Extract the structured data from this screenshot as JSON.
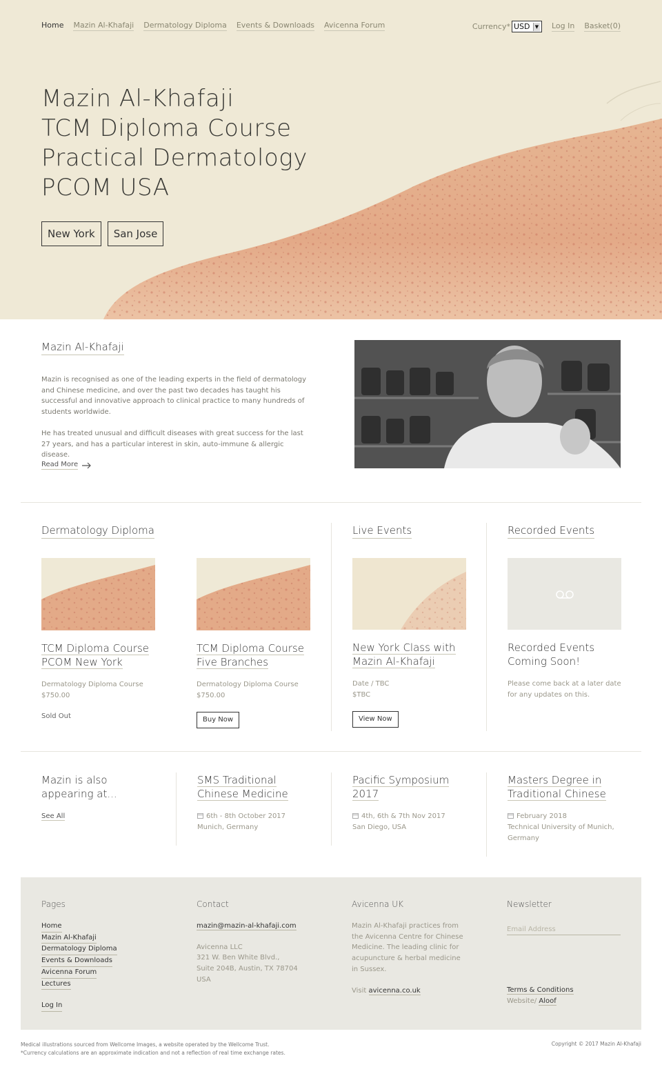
{
  "nav": {
    "items": [
      {
        "label": "Home"
      },
      {
        "label": "Mazin Al-Khafaji"
      },
      {
        "label": "Dermatology Diploma"
      },
      {
        "label": "Events & Downloads"
      },
      {
        "label": "Avicenna Forum"
      }
    ],
    "currency_label": "Currency*",
    "currency_value": "USD",
    "login": "Log In",
    "basket": "Basket(0)"
  },
  "hero": {
    "lines": [
      "Mazin Al-Khafaji",
      "TCM Diploma Course",
      "Practical Dermatology",
      "PCOM USA"
    ],
    "buttons": [
      "New York",
      "San Jose"
    ]
  },
  "about": {
    "title": "Mazin Al-Khafaji",
    "para1": "Mazin is recognised as one of the leading experts in the field of dermatology and Chinese medicine, and over the past two decades has taught his successful and innovative approach to clinical practice to many hundreds of students worldwide.",
    "para2": "He has treated unusual and difficult diseases with great success for the last 27 years, and has a particular interest in skin, auto-immune & allergic disease.",
    "read_more": "Read More"
  },
  "products": {
    "diploma_title": "Dermatology Diploma",
    "live_title": "Live Events",
    "recorded_title": "Recorded Events",
    "cards": [
      {
        "title": "TCM Diploma Course PCOM New York",
        "category": "Dermatology Diploma Course",
        "price": "$750.00",
        "status": "Sold Out"
      },
      {
        "title": "TCM Diploma Course Five Branches",
        "category": "Dermatology Diploma Course",
        "price": "$750.00",
        "button": "Buy Now"
      },
      {
        "title": "New York Class with Mazin Al-Khafaji",
        "category": "Date / TBC",
        "price": "$TBC",
        "button": "View Now"
      },
      {
        "title": "Recorded Events Coming Soon!",
        "text": "Please come back at a later date for any updates on this."
      }
    ]
  },
  "appearing": {
    "title": "Mazin is also appearing at...",
    "see_all": "See All",
    "events": [
      {
        "title": "SMS Traditional Chinese Medicine",
        "date": "6th - 8th October 2017",
        "place": "Munich, Germany"
      },
      {
        "title": "Pacific Symposium 2017",
        "date": "4th, 6th & 7th Nov 2017",
        "place": "San Diego, USA"
      },
      {
        "title": "Masters Degree in Traditional Chinese",
        "date": "February 2018",
        "place": "Technical University of Munich, Germany"
      }
    ]
  },
  "footer": {
    "pages_title": "Pages",
    "pages": [
      "Home",
      "Mazin Al-Khafaji",
      "Dermatology Diploma",
      "Events & Downloads",
      "Avicenna Forum",
      "Lectures"
    ],
    "login": "Log In",
    "contact_title": "Contact",
    "email": "mazin@mazin-al-khafaji.com",
    "address": [
      "Avicenna LLC",
      "321 W. Ben White Blvd.,",
      "Suite 204B, Austin, TX 78704 USA"
    ],
    "avicenna_title": "Avicenna UK",
    "avicenna_text": "Mazin Al-Khafaji practices from the Avicenna Centre for Chinese Medicine. The leading clinic for acupuncture & herbal medicine in Sussex.",
    "visit_label": "Visit",
    "visit_link": "avicenna.co.uk",
    "newsletter_title": "Newsletter",
    "email_placeholder": "Email Address",
    "terms": "Terms & Conditions",
    "website_label": "Website/",
    "website_link": "Aloof"
  },
  "bottom": {
    "credit": "Medical illustrations sourced from Wellcome Images, a website operated by the Wellcome Trust.",
    "currency_note": "*Currency calculations are an approximate indication and not a reflection of real time exchange rates.",
    "copyright": "Copyright © 2017 Mazin Al-Khafaji"
  },
  "colors": {
    "hero_bg": "#efe9d6",
    "skin": "#e2a684",
    "footer_bg": "#e9e8e2"
  }
}
